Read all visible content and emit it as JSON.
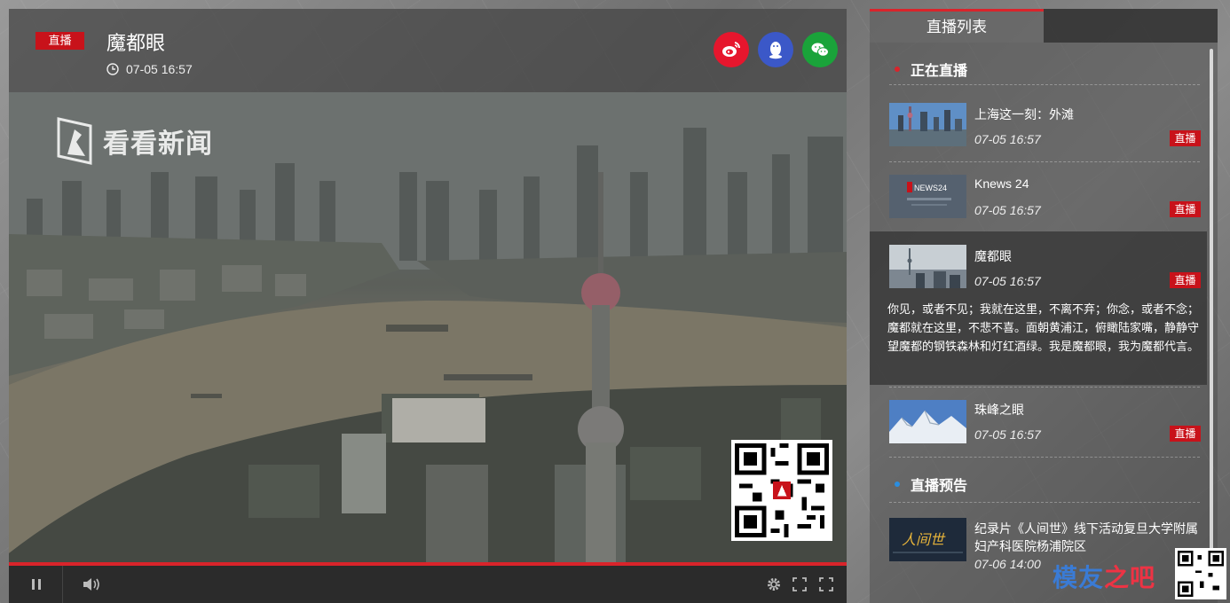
{
  "player": {
    "live_badge": "直播",
    "title": "魔都眼",
    "time": "07-05 16:57",
    "watermark": "看看新闻",
    "share": [
      {
        "icon": "weibo-icon",
        "color": "#e6162d"
      },
      {
        "icon": "qq-icon",
        "color": "#3b58c8"
      },
      {
        "icon": "wechat-icon",
        "color": "#1aa33a"
      }
    ]
  },
  "sidebar": {
    "tab_title": "直播列表",
    "section_live": "正在直播",
    "section_preview": "直播预告",
    "items": [
      {
        "name": "上海这一刻：外滩",
        "time": "07-05 16:57",
        "tag": "直播"
      },
      {
        "name": "Knews 24",
        "time": "07-05 16:57",
        "tag": "直播",
        "thumb_text": "NEWS24"
      },
      {
        "name": "魔都眼",
        "time": "07-05 16:57",
        "tag": "直播",
        "desc": "你见，或者不见；我就在这里，不离不弃；你念，或者不念；魔都就在这里，不悲不喜。面朝黄浦江，俯瞰陆家嘴，静静守望魔都的钢铁森林和灯红酒绿。我是魔都眼，我为魔都代言。"
      },
      {
        "name": "珠峰之眼",
        "time": "07-05 16:57",
        "tag": "直播"
      },
      {
        "name": "纪录片《人间世》线下活动复旦大学附属妇产科医院杨浦院区",
        "time": "07-06 14:00",
        "thumb_text": "人间世"
      }
    ]
  },
  "brand": {
    "main": "模友",
    "sub": "之吧"
  },
  "colors": {
    "accent": "#d9242b",
    "badge": "#c8121a"
  }
}
